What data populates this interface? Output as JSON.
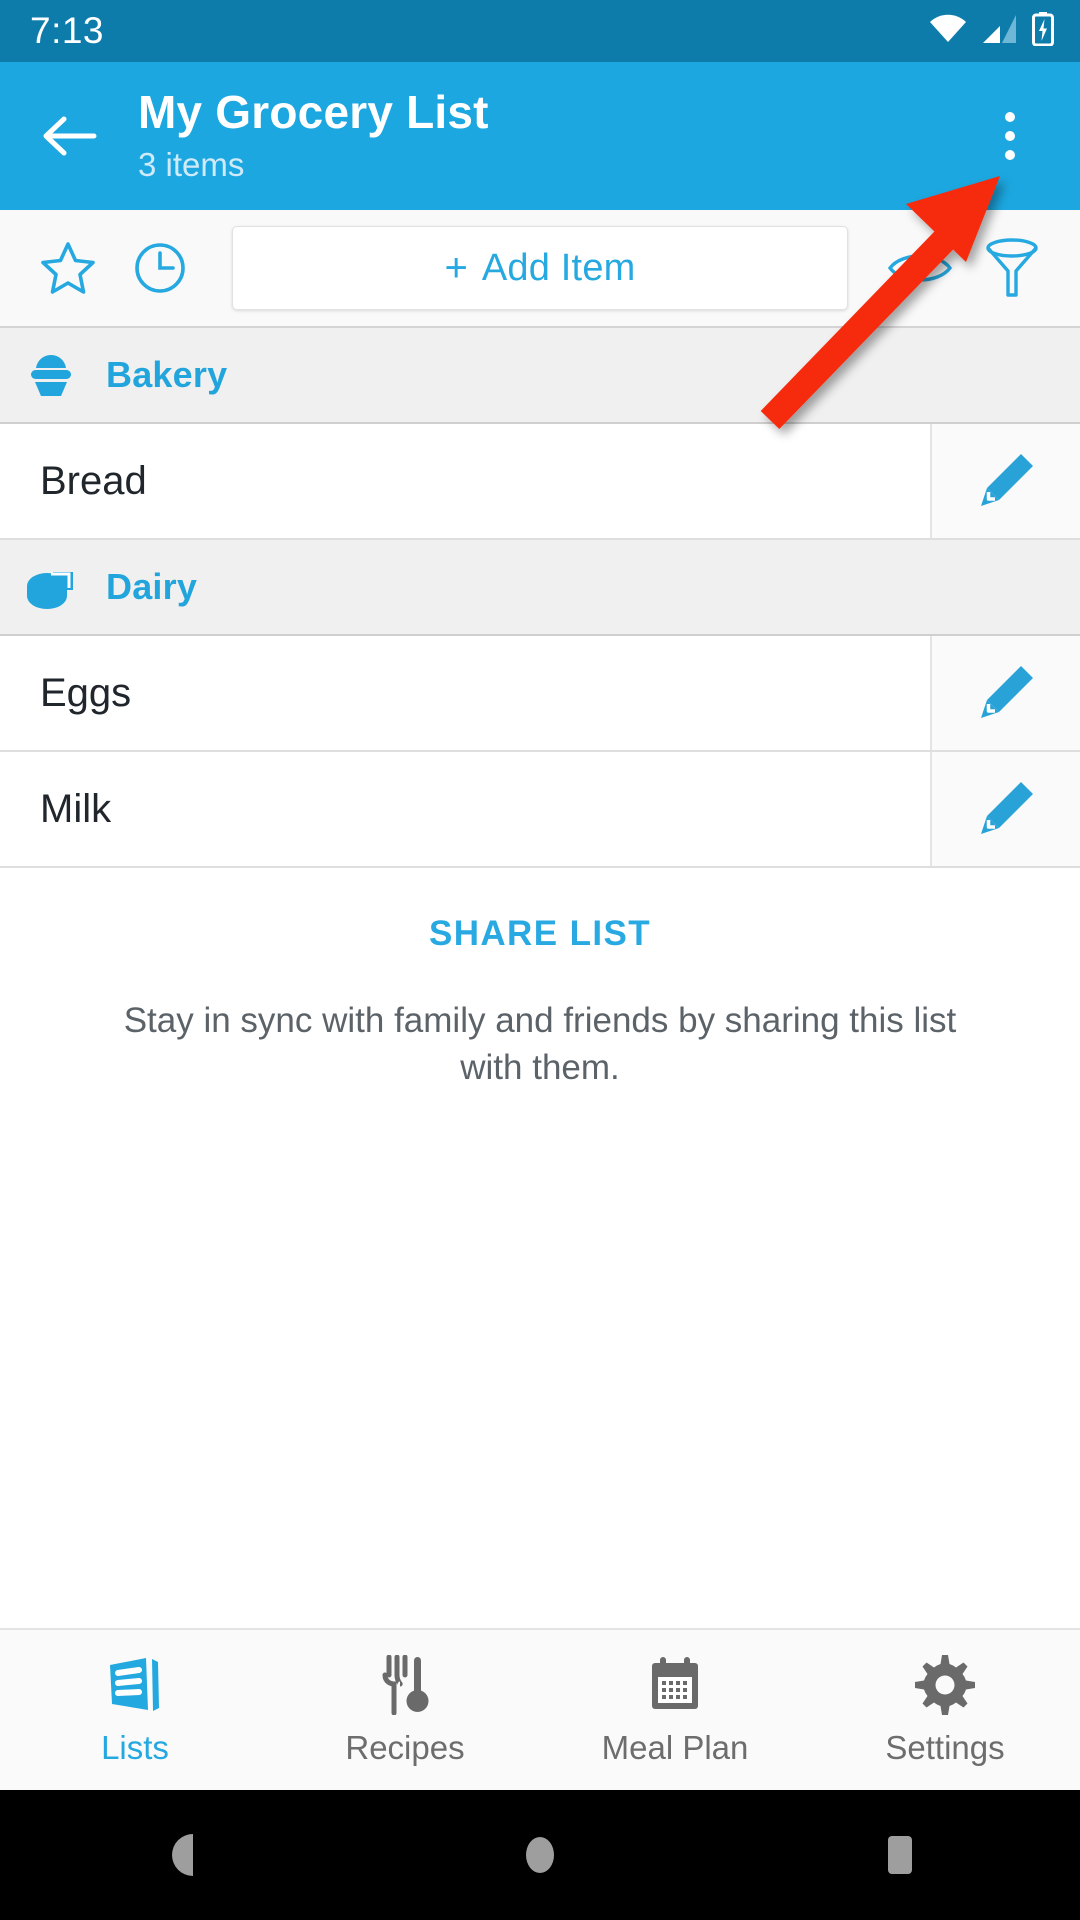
{
  "status_bar": {
    "time": "7:13",
    "icons": [
      "wifi-icon",
      "cell-signal-icon",
      "battery-charging-icon"
    ],
    "background": "#0d7cab"
  },
  "app_bar": {
    "back_icon": "back-arrow-icon",
    "title": "My Grocery List",
    "subtitle": "3 items",
    "overflow_icon": "overflow-menu-icon",
    "background": "#1ca7e0"
  },
  "action_bar": {
    "left_icons": [
      {
        "name": "star-icon",
        "label": "Favorite"
      },
      {
        "name": "clock-icon",
        "label": "History"
      }
    ],
    "add_item": {
      "plus": "+",
      "label": "Add Item"
    },
    "right_icons": [
      {
        "name": "eye-icon",
        "label": "Show hidden"
      },
      {
        "name": "filter-funnel-icon",
        "label": "Filter"
      }
    ]
  },
  "sections": [
    {
      "name": "Bakery",
      "icon": "cupcake-icon",
      "items": [
        {
          "name": "Bread",
          "edit_icon": "pencil-edit-icon"
        }
      ]
    },
    {
      "name": "Dairy",
      "icon": "cheese-icon",
      "items": [
        {
          "name": "Eggs",
          "edit_icon": "pencil-edit-icon"
        },
        {
          "name": "Milk",
          "edit_icon": "pencil-edit-icon"
        }
      ]
    }
  ],
  "share": {
    "link_label": "SHARE LIST",
    "description": "Stay in sync with family and friends by sharing this list with them."
  },
  "bottom_nav": {
    "tabs": [
      {
        "label": "Lists",
        "icon": "lists-icon",
        "active": true
      },
      {
        "label": "Recipes",
        "icon": "fork-spoon-icon",
        "active": false
      },
      {
        "label": "Meal Plan",
        "icon": "calendar-icon",
        "active": false
      },
      {
        "label": "Settings",
        "icon": "gear-icon",
        "active": false
      }
    ]
  },
  "android_nav": {
    "buttons": [
      "back-triangle-icon",
      "home-circle-icon",
      "recents-square-icon"
    ]
  },
  "annotation": {
    "type": "arrow",
    "color": "#f62a0c",
    "points_to": "overflow-menu-icon"
  },
  "colors": {
    "accent": "#25a9e0",
    "app_bar": "#1ca7e0",
    "status_bar": "#0d7cab",
    "section_header_bg": "#f0f0f0",
    "annotation_red": "#f62a0c"
  }
}
